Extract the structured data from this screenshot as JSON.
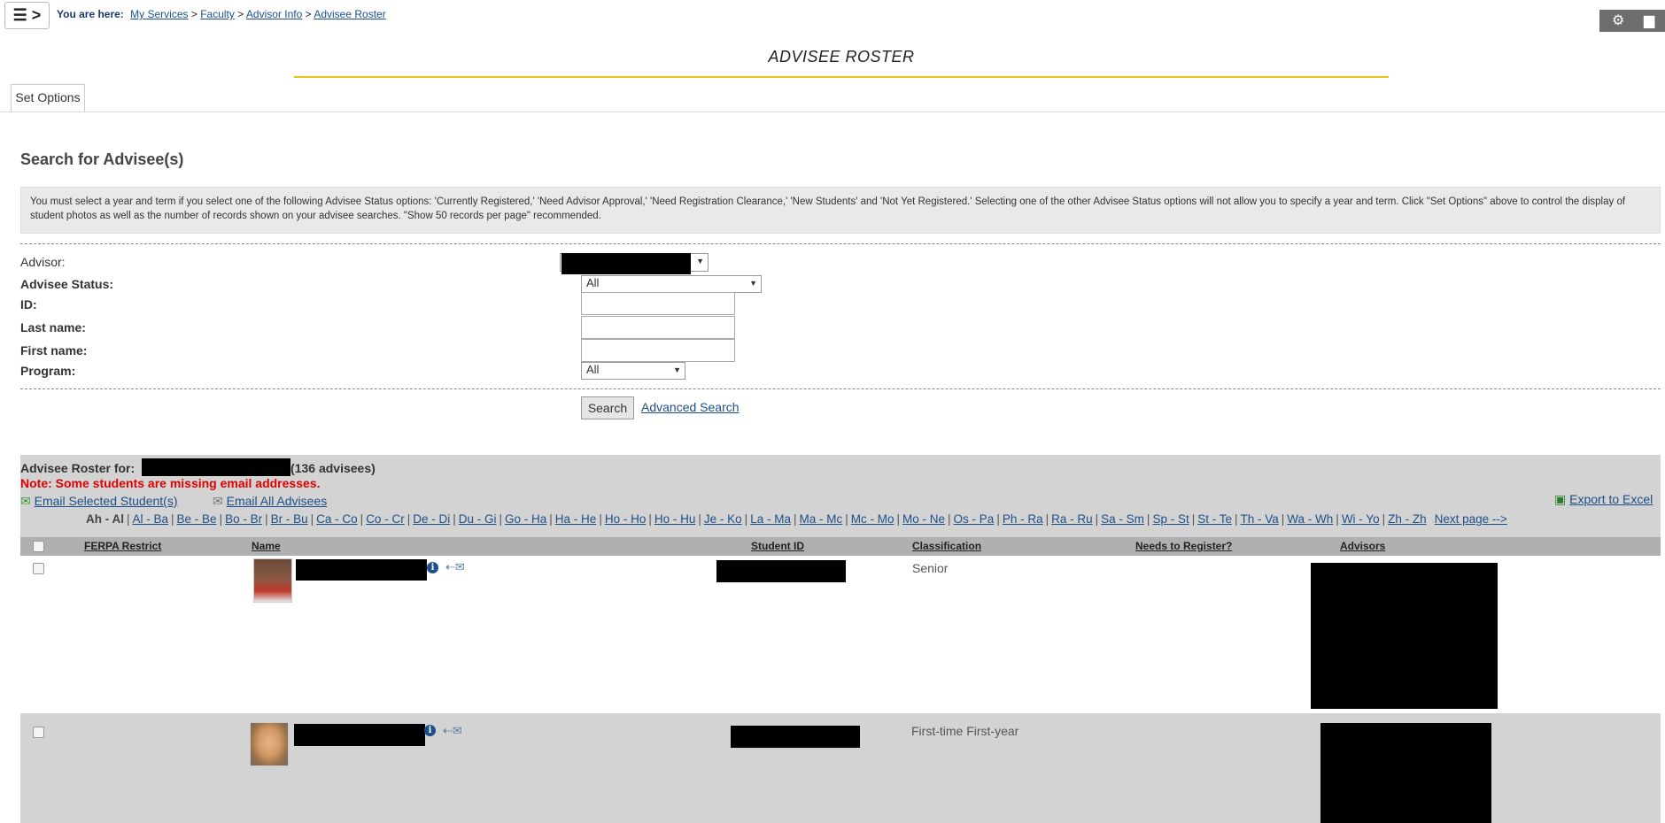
{
  "breadcrumb": {
    "prefix": "You are here:",
    "items": [
      "My Services",
      "Faculty",
      "Advisor Info",
      "Advisee Roster"
    ],
    "separator": ">"
  },
  "header": {
    "menu_icon": "☰ >",
    "tools": [
      "gear-icon",
      "print-icon"
    ]
  },
  "page_title": "ADVISEE ROSTER",
  "tabs": {
    "set_options": "Set Options"
  },
  "search": {
    "heading": "Search for Advisee(s)",
    "instructions": "You must select a year and term if you select one of the following Advisee Status options: 'Currently Registered,' 'Need Advisor Approval,' 'Need Registration Clearance,' 'New Students' and 'Not Yet Registered.' Selecting one of the other Advisee Status options will not allow you to specify a year and term. Click \"Set Options\" above to control the display of student photos as well as the number of records shown on your advisee searches. \"Show 50 records per page\" recommended.",
    "labels": {
      "advisor": "Advisor:",
      "status": "Advisee Status:",
      "id": "ID:",
      "last_name": "Last name:",
      "first_name": "First name:",
      "program": "Program:"
    },
    "status_value": "All",
    "program_value": "All",
    "search_button": "Search",
    "advanced_search": "Advanced Search"
  },
  "roster": {
    "header_prefix": "Advisee Roster for:",
    "count_text": "(136 advisees)",
    "note": "Note: Some students are missing email addresses.",
    "email_selected": "Email Selected Student(s)",
    "email_all": "Email All Advisees",
    "export": "Export to Excel",
    "current_range": "Ah - Al",
    "ranges": [
      "Al - Ba",
      "Be - Be",
      "Bo - Br",
      "Br - Bu",
      "Ca - Co",
      "Co - Cr",
      "De - Di",
      "Du - Gi",
      "Go - Ha",
      "Ha - He",
      "Ho - Ho",
      "Ho - Hu",
      "Je - Ko",
      "La - Ma",
      "Ma - Mc",
      "Mc - Mo",
      "Mo - Ne",
      "Os - Pa",
      "Ph - Ra",
      "Ra - Ru",
      "Sa - Sm",
      "Sp - St",
      "St - Te",
      "Th - Va",
      "Wa - Wh",
      "Wi - Yo",
      "Zh - Zh"
    ],
    "next_page": "Next page -->",
    "columns": [
      "FERPA Restrict",
      "Name",
      "Student ID",
      "Classification",
      "Needs to Register?",
      "Advisors"
    ],
    "rows": [
      {
        "classification": "Senior"
      },
      {
        "classification": "First-time First-year"
      }
    ]
  }
}
